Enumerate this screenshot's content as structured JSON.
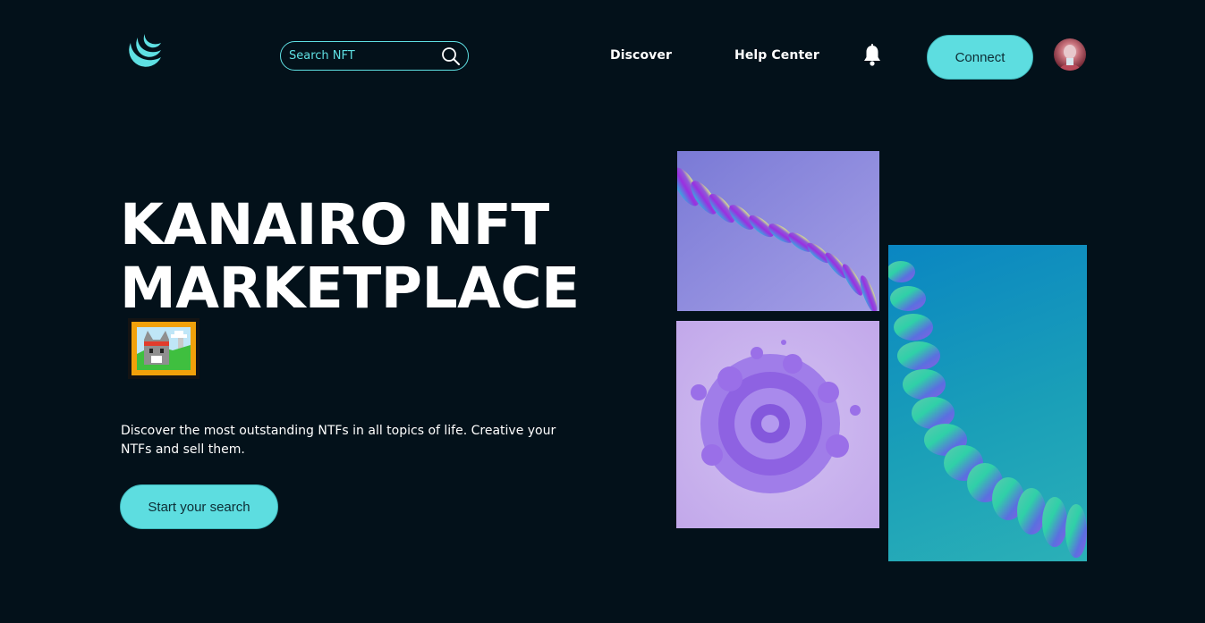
{
  "header": {
    "logo_icon": "crescent-logo-icon",
    "search": {
      "placeholder": "Search NFT",
      "icon": "search-icon"
    },
    "nav": [
      {
        "label": "Discover"
      },
      {
        "label": "Help Center"
      }
    ],
    "bell_icon": "bell-icon",
    "connect_label": "Connect",
    "avatar_icon": "avatar"
  },
  "hero": {
    "title_line1": "KANAIRO NFT",
    "title_line2": "MARKETPLACE",
    "framed_picture_icon": "framed-picture-icon",
    "description": "Discover the most outstanding NTFs in all topics of life. Creative your NTFs and sell them.",
    "cta_label": "Start your search"
  },
  "gallery": [
    {
      "name": "purple-wave-art"
    },
    {
      "name": "lilac-swirl-art"
    },
    {
      "name": "teal-wave-art"
    }
  ],
  "colors": {
    "background": "#03111a",
    "accent": "#5ddde0",
    "text": "#ffffff"
  }
}
